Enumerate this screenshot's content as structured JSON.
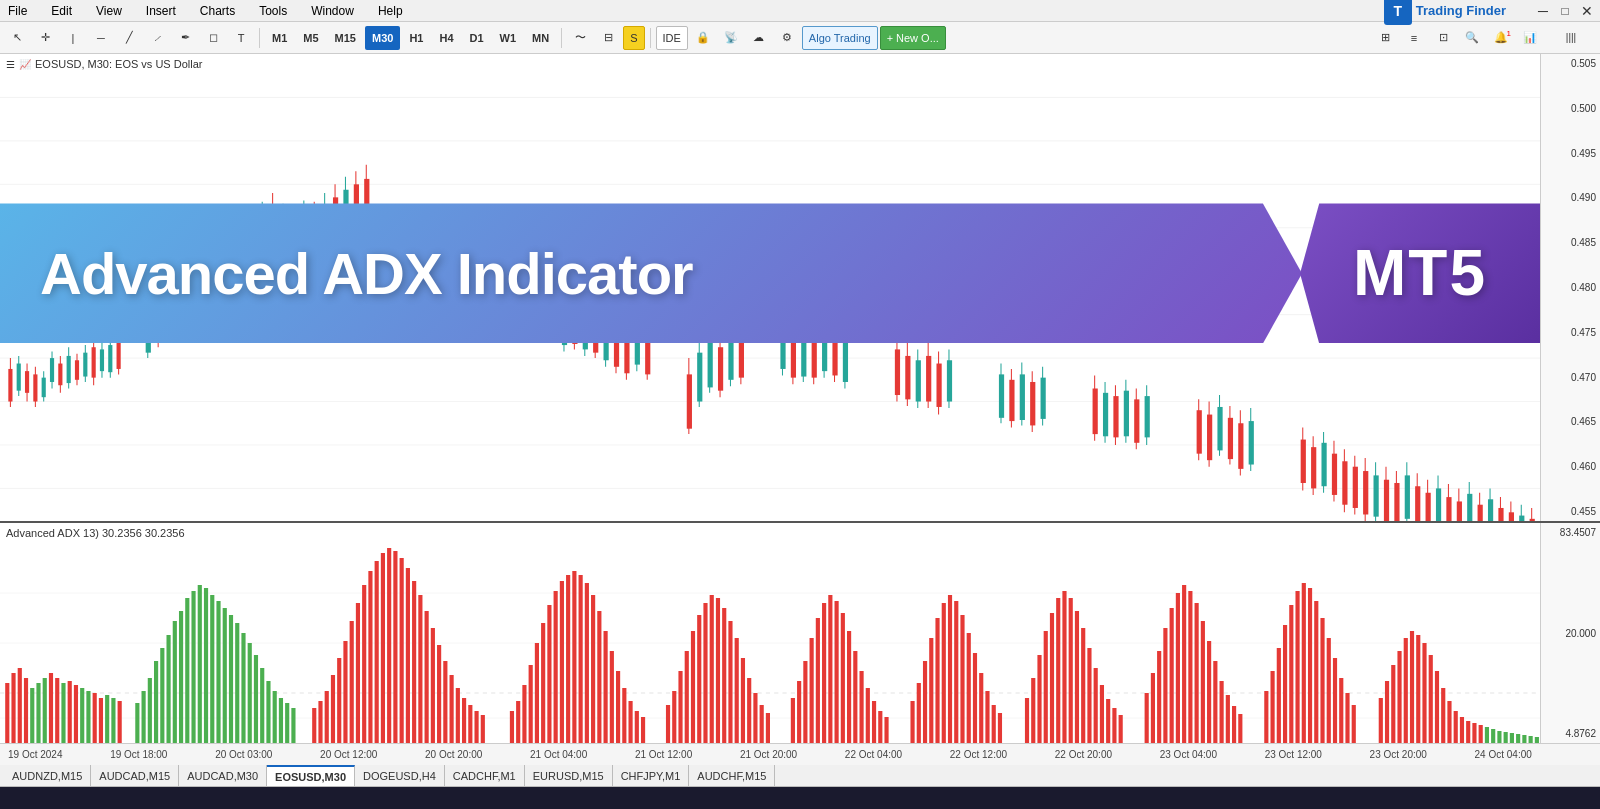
{
  "menubar": {
    "items": [
      "File",
      "Edit",
      "View",
      "Insert",
      "Charts",
      "Tools",
      "Window",
      "Help"
    ]
  },
  "toolbar": {
    "timeframes": [
      "M1",
      "M5",
      "M15",
      "M30",
      "H1",
      "H4",
      "D1",
      "W1",
      "MN"
    ],
    "active_tf": "M30",
    "buttons": {
      "ide": "IDE",
      "algo_trading": "Algo Trading",
      "new_order": "New O..."
    }
  },
  "chart": {
    "symbol_label": "EOSUSD, M30:  EOS vs US Dollar",
    "price_levels": [
      "0.505",
      "0.500",
      "0.495",
      "0.490",
      "0.485",
      "0.480",
      "0.475",
      "0.470",
      "0.465",
      "0.460",
      "0.455"
    ],
    "banner_title": "Advanced ADX Indicator",
    "banner_platform": "MT5"
  },
  "adx_indicator": {
    "label": "Advanced ADX 13) 30.2356 30.2356",
    "right_values": [
      "83.4507",
      "20.000",
      "4.8762"
    ]
  },
  "time_labels": [
    "19 Oct 2024",
    "19 Oct 18:00",
    "20 Oct 03:00",
    "20 Oct 12:00",
    "20 Oct 20:00",
    "21 Oct 04:00",
    "21 Oct 12:00",
    "21 Oct 20:00",
    "22 Oct 04:00",
    "22 Oct 12:00",
    "22 Oct 20:00",
    "23 Oct 04:00",
    "23 Oct 12:00",
    "23 Oct 20:00",
    "24 Oct 04:00"
  ],
  "symbol_tabs": [
    {
      "label": "AUDNZD,M15",
      "active": false
    },
    {
      "label": "AUDCAD,M15",
      "active": false
    },
    {
      "label": "AUDCAD,M30",
      "active": false
    },
    {
      "label": "EOSUSD,M30",
      "active": true
    },
    {
      "label": "DOGEUSD,H4",
      "active": false
    },
    {
      "label": "CADCHF,M1",
      "active": false
    },
    {
      "label": "EURUSD,M15",
      "active": false
    },
    {
      "label": "CHFJPY,M1",
      "active": false
    },
    {
      "label": "AUDCHF,M15",
      "active": false
    }
  ],
  "logo": {
    "text": "Trading Finder"
  }
}
